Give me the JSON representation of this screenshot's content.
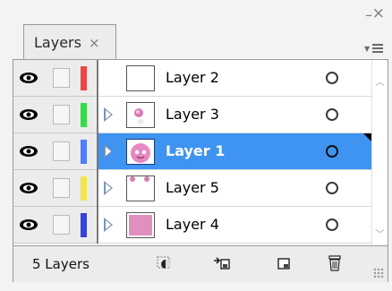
{
  "panel": {
    "tab_label": "Layers",
    "tab_close_glyph": "×",
    "minimize_glyph": "–",
    "close_glyph": "×"
  },
  "layers": [
    {
      "name": "Layer 2",
      "color": "#ee4444",
      "visible": true,
      "expandable": false,
      "selected": false,
      "thumbnail": "blank-white"
    },
    {
      "name": "Layer 3",
      "color": "#33dd44",
      "visible": true,
      "expandable": true,
      "selected": false,
      "thumbnail": "pink-blob-small"
    },
    {
      "name": "Layer 1",
      "color": "#4f7dff",
      "visible": true,
      "expandable": true,
      "selected": true,
      "thumbnail": "pink-face"
    },
    {
      "name": "Layer 5",
      "color": "#f2e64a",
      "visible": true,
      "expandable": true,
      "selected": false,
      "thumbnail": "white-with-pink-marks"
    },
    {
      "name": "Layer 4",
      "color": "#3344dd",
      "visible": true,
      "expandable": true,
      "selected": false,
      "thumbnail": "pink-fill"
    }
  ],
  "footer": {
    "count_label": "5 Layers",
    "buttons": [
      "make-clipping-mask-icon",
      "create-sublayer-icon",
      "new-layer-icon",
      "trash-icon"
    ]
  },
  "colors": {
    "selection": "#3f93f1",
    "panel_bg": "#ececec"
  }
}
